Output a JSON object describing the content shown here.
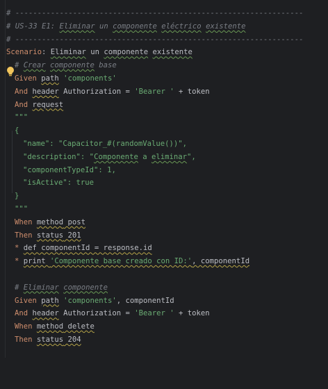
{
  "editor": {
    "lines": [
      {
        "id": "sep1",
        "parts": [
          {
            "t": "# -----------------------------------------------------------------",
            "c": "cmt-plain"
          }
        ]
      },
      {
        "id": "title",
        "parts": [
          {
            "t": "# US-33 E1: ",
            "c": "cmt"
          },
          {
            "t": "Eliminar",
            "c": "cmt squig"
          },
          {
            "t": " un ",
            "c": "cmt"
          },
          {
            "t": "componente",
            "c": "cmt squig"
          },
          {
            "t": " ",
            "c": "cmt"
          },
          {
            "t": "eléctrico",
            "c": "cmt squig"
          },
          {
            "t": " ",
            "c": "cmt"
          },
          {
            "t": "existente",
            "c": "cmt squig"
          }
        ]
      },
      {
        "id": "sep2",
        "parts": [
          {
            "t": "# -----------------------------------------------------------------",
            "c": "cmt-plain"
          }
        ]
      },
      {
        "id": "scenario",
        "parts": [
          {
            "t": "Scenario",
            "c": "kw"
          },
          {
            "t": ": ",
            "c": "punc"
          },
          {
            "t": "Eliminar",
            "c": "punc squig"
          },
          {
            "t": " un ",
            "c": "punc"
          },
          {
            "t": "componente",
            "c": "punc squig"
          },
          {
            "t": " ",
            "c": "punc"
          },
          {
            "t": "existente",
            "c": "punc squig"
          }
        ]
      },
      {
        "id": "c1",
        "indent": 1,
        "parts": [
          {
            "t": "# ",
            "c": "cmt"
          },
          {
            "t": "Crear",
            "c": "cmt squig"
          },
          {
            "t": " ",
            "c": "cmt"
          },
          {
            "t": "componente",
            "c": "cmt squig"
          },
          {
            "t": " base",
            "c": "cmt"
          }
        ]
      },
      {
        "id": "given1",
        "indent": 1,
        "parts": [
          {
            "t": "Given ",
            "c": "kw"
          },
          {
            "t": "path",
            "c": "punc squig-y"
          },
          {
            "t": " 'components'",
            "c": "str"
          }
        ]
      },
      {
        "id": "and1",
        "indent": 1,
        "parts": [
          {
            "t": "And ",
            "c": "kw"
          },
          {
            "t": "header",
            "c": "punc squig-y"
          },
          {
            "t": " Authorization = ",
            "c": "punc"
          },
          {
            "t": "'Bearer '",
            "c": "str"
          },
          {
            "t": " + token",
            "c": "punc"
          }
        ]
      },
      {
        "id": "and2",
        "indent": 1,
        "parts": [
          {
            "t": "And ",
            "c": "kw"
          },
          {
            "t": "request",
            "c": "punc squig-y"
          }
        ]
      },
      {
        "id": "doc1",
        "indent": 1,
        "parts": [
          {
            "t": "\"\"\"",
            "c": "str"
          }
        ]
      },
      {
        "id": "brace1",
        "indent": 1,
        "parts": [
          {
            "t": "{",
            "c": "str"
          }
        ]
      },
      {
        "id": "name",
        "indent": 2,
        "parts": [
          {
            "t": "\"name\": \"Capacitor_#(randomValue())\",",
            "c": "str"
          }
        ]
      },
      {
        "id": "desc",
        "indent": 2,
        "parts": [
          {
            "t": "\"description\": \"",
            "c": "str"
          },
          {
            "t": "Componente",
            "c": "str squig"
          },
          {
            "t": " a ",
            "c": "str"
          },
          {
            "t": "eliminar",
            "c": "str squig"
          },
          {
            "t": "\",",
            "c": "str"
          }
        ]
      },
      {
        "id": "type",
        "indent": 2,
        "parts": [
          {
            "t": "\"componentTypeId\": 1,",
            "c": "str"
          }
        ]
      },
      {
        "id": "active",
        "indent": 2,
        "parts": [
          {
            "t": "\"isActive\": true",
            "c": "str"
          }
        ]
      },
      {
        "id": "brace2",
        "indent": 1,
        "parts": [
          {
            "t": "}",
            "c": "str"
          }
        ]
      },
      {
        "id": "doc2",
        "indent": 1,
        "parts": [
          {
            "t": "\"\"\"",
            "c": "str"
          }
        ]
      },
      {
        "id": "when1",
        "indent": 1,
        "parts": [
          {
            "t": "When ",
            "c": "kw"
          },
          {
            "t": "method",
            "c": "punc squig-y"
          },
          {
            "t": " post",
            "c": "punc squig-y"
          }
        ]
      },
      {
        "id": "then1",
        "indent": 1,
        "parts": [
          {
            "t": "Then ",
            "c": "kw"
          },
          {
            "t": "status",
            "c": "punc squig-y"
          },
          {
            "t": " 201",
            "c": "punc squig-y"
          }
        ]
      },
      {
        "id": "star1",
        "indent": 1,
        "parts": [
          {
            "t": "* ",
            "c": "kw"
          },
          {
            "t": "def componentId = response.id",
            "c": "punc squig-y"
          }
        ]
      },
      {
        "id": "star2",
        "indent": 1,
        "parts": [
          {
            "t": "* ",
            "c": "kw"
          },
          {
            "t": "print ",
            "c": "punc squig-y"
          },
          {
            "t": "'Componente base creado con ID:'",
            "c": "str squig-y"
          },
          {
            "t": ", componentId",
            "c": "punc squig-y"
          }
        ]
      },
      {
        "id": "blank1",
        "indent": 1,
        "parts": [
          {
            "t": "",
            "c": "punc"
          }
        ]
      },
      {
        "id": "c2",
        "indent": 1,
        "parts": [
          {
            "t": "# ",
            "c": "cmt"
          },
          {
            "t": "Eliminar",
            "c": "cmt squig"
          },
          {
            "t": " ",
            "c": "cmt"
          },
          {
            "t": "componente",
            "c": "cmt squig"
          }
        ]
      },
      {
        "id": "given2",
        "indent": 1,
        "parts": [
          {
            "t": "Given ",
            "c": "kw"
          },
          {
            "t": "path",
            "c": "punc squig-y"
          },
          {
            "t": " 'components'",
            "c": "str"
          },
          {
            "t": ", componentId",
            "c": "punc"
          }
        ]
      },
      {
        "id": "and3",
        "indent": 1,
        "parts": [
          {
            "t": "And ",
            "c": "kw"
          },
          {
            "t": "header",
            "c": "punc squig-y"
          },
          {
            "t": " Authorization = ",
            "c": "punc"
          },
          {
            "t": "'Bearer '",
            "c": "str"
          },
          {
            "t": " + token",
            "c": "punc"
          }
        ]
      },
      {
        "id": "when2",
        "indent": 1,
        "parts": [
          {
            "t": "When ",
            "c": "kw"
          },
          {
            "t": "method",
            "c": "punc squig-y"
          },
          {
            "t": " delete",
            "c": "punc squig-y"
          }
        ]
      },
      {
        "id": "then2",
        "indent": 1,
        "parts": [
          {
            "t": "Then ",
            "c": "kw"
          },
          {
            "t": "status",
            "c": "punc squig-y"
          },
          {
            "t": " 204",
            "c": "punc squig-y"
          }
        ]
      }
    ],
    "intention_icon": "lightbulb-icon"
  }
}
